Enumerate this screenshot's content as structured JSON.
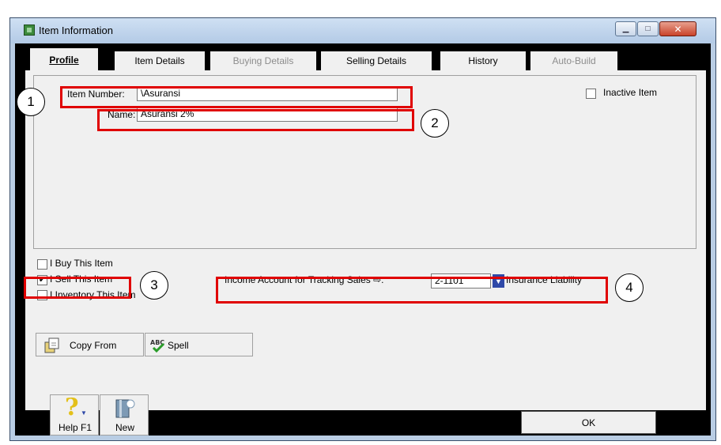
{
  "window": {
    "title": "Item Information"
  },
  "tabs": [
    {
      "label": "Profile",
      "state": "active"
    },
    {
      "label": "Item Details",
      "state": "enabled"
    },
    {
      "label": "Buying Details",
      "state": "disabled"
    },
    {
      "label": "Selling Details",
      "state": "enabled"
    },
    {
      "label": "History",
      "state": "enabled"
    },
    {
      "label": "Auto-Build",
      "state": "disabled"
    }
  ],
  "profile": {
    "item_number_label": "Item Number:",
    "item_number_value": "\\Asuransi",
    "name_label": "Name:",
    "name_value": "Asuransi 2%",
    "inactive_label": "Inactive Item",
    "inactive_checked": false,
    "buy_label": "I Buy This Item",
    "buy_checked": false,
    "sell_label": "I Sell This Item",
    "sell_checked": true,
    "inventory_label": "I Inventory This Item",
    "inventory_checked": false,
    "income_account_label": "Income Account for Tracking Sales",
    "income_account_value": "2-1101",
    "income_account_name": "Insurance Liability"
  },
  "annotations": [
    "1",
    "2",
    "3",
    "4"
  ],
  "buttons": {
    "copy_from": "Copy From",
    "spell": "Spell",
    "help": "Help F1",
    "new": "New",
    "ok": "OK"
  },
  "icons": {
    "app": "app-icon",
    "copy": "copy-icon",
    "spell": "spell-check-icon",
    "help": "help-question-icon",
    "new": "new-item-icon",
    "arrow": "arrow-icon"
  },
  "colors": {
    "highlight": "#e00000",
    "titlebar": "#b9cde4",
    "panel": "#f0f0f0"
  }
}
